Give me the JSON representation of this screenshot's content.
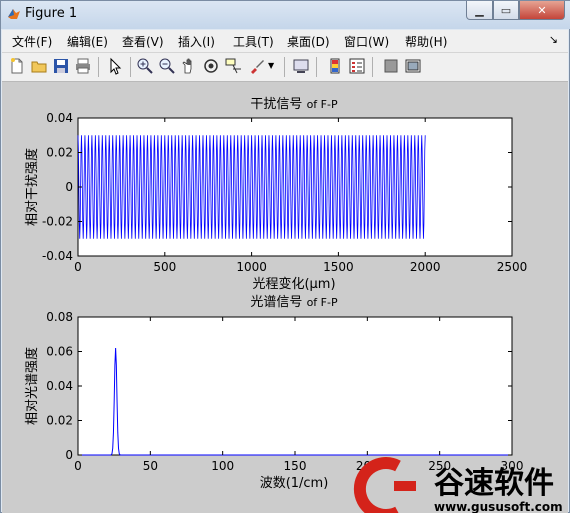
{
  "window": {
    "title": "Figure 1"
  },
  "menu": [
    "文件(F)",
    "编辑(E)",
    "查看(V)",
    "插入(I)",
    "工具(T)",
    "桌面(D)",
    "窗口(W)",
    "帮助(H)"
  ],
  "menu_arrow": "↘",
  "toolbar": [
    "new-icon",
    "open-icon",
    "save-icon",
    "print-icon",
    "pointer-icon",
    "zoom-in-icon",
    "zoom-out-icon",
    "pan-icon",
    "rotate-icon",
    "data-cursor-icon",
    "brush-icon",
    "link-icon",
    "colorbar-icon",
    "legend-icon",
    "hide-plot-tools-icon",
    "show-plot-tools-icon"
  ],
  "chart_data": [
    {
      "type": "line",
      "title_cn": "干扰信号",
      "title_suffix": "of F-P",
      "xlabel": "光程变化(μm)",
      "ylabel": "相对干扰强度",
      "xlim": [
        0,
        2500
      ],
      "ylim": [
        -0.04,
        0.04
      ],
      "xticks": [
        0,
        500,
        1000,
        1500,
        2000,
        2500
      ],
      "yticks": [
        -0.04,
        -0.02,
        0,
        0.02,
        0.04
      ],
      "series": [
        {
          "color": "#0000ff",
          "x_range": [
            0,
            2000
          ],
          "amplitude": 0.03,
          "cycles": 100
        }
      ]
    },
    {
      "type": "line",
      "title_cn": "光谱信号",
      "title_suffix": "of F-P",
      "xlabel": "波数(1/cm)",
      "ylabel": "相对光谱强度",
      "xlim": [
        0,
        300
      ],
      "ylim": [
        0,
        0.08
      ],
      "xticks": [
        0,
        50,
        100,
        150,
        200,
        250,
        300
      ],
      "yticks": [
        0,
        0.02,
        0.04,
        0.06,
        0.08
      ],
      "series": [
        {
          "color": "#0000ff",
          "peak_x": 26,
          "peak_y": 0.062,
          "width": 1.2
        }
      ]
    }
  ],
  "watermark": {
    "brand": "谷速软件",
    "url": "www.gususoft.com",
    "color": "#d4231a"
  }
}
